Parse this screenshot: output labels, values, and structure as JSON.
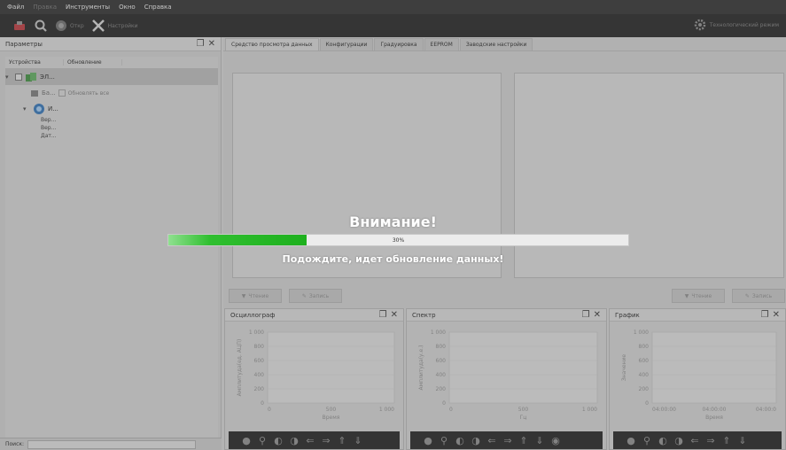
{
  "menu": {
    "items": [
      {
        "label": "Файл",
        "disabled": false
      },
      {
        "label": "Правка",
        "disabled": true
      },
      {
        "label": "Инструменты",
        "disabled": false
      },
      {
        "label": "Окно",
        "disabled": false
      },
      {
        "label": "Справка",
        "disabled": false
      }
    ]
  },
  "toolbar": {
    "open_label": "Откр",
    "settings_label": "Настройки",
    "right_label": "Технологический режим"
  },
  "left_panel": {
    "title": "Параметры",
    "columns": [
      "Устройства",
      "Обновление"
    ],
    "tree": {
      "root_label": "ЭЛ...",
      "battery_label": "Ба...",
      "update_all_label": "Обновлять все",
      "device_label": "И...",
      "sub_items": [
        "Вер...",
        "Вер...",
        "Дат..."
      ]
    },
    "search_label": "Поиск:"
  },
  "main": {
    "tabs": [
      "Средство просмотра данных",
      "Конфигурации",
      "Градуировка",
      "EEPROM",
      "Заводские настройки"
    ],
    "read_label": "Чтение",
    "write_label": "Запись"
  },
  "panels": {
    "oscillograph": {
      "title": "Осциллограф",
      "ylabel": "Амплитуда(ед. АЦП)",
      "xlabel": "Время",
      "yticks": [
        "1 000",
        "800",
        "600",
        "400",
        "200",
        "0"
      ],
      "xticks": [
        "0",
        "500",
        "1 000"
      ]
    },
    "spectrum": {
      "title": "Спектр",
      "ylabel": "Амплитуда(у.е.)",
      "xlabel": "Гц",
      "yticks": [
        "1 000",
        "800",
        "600",
        "400",
        "200",
        "0"
      ],
      "xticks": [
        "0",
        "500",
        "1 000"
      ]
    },
    "graph": {
      "title": "График",
      "ylabel": "Значение",
      "xlabel": "Время",
      "yticks": [
        "1 000",
        "800",
        "600",
        "400",
        "200",
        "0"
      ],
      "xticks": [
        "04:00:00",
        "04:00:00",
        "04:00:0"
      ]
    }
  },
  "overlay": {
    "title": "Внимание!",
    "progress_percent": 30,
    "progress_text": "30%",
    "message": "Подождите, идет обновление данных!"
  }
}
